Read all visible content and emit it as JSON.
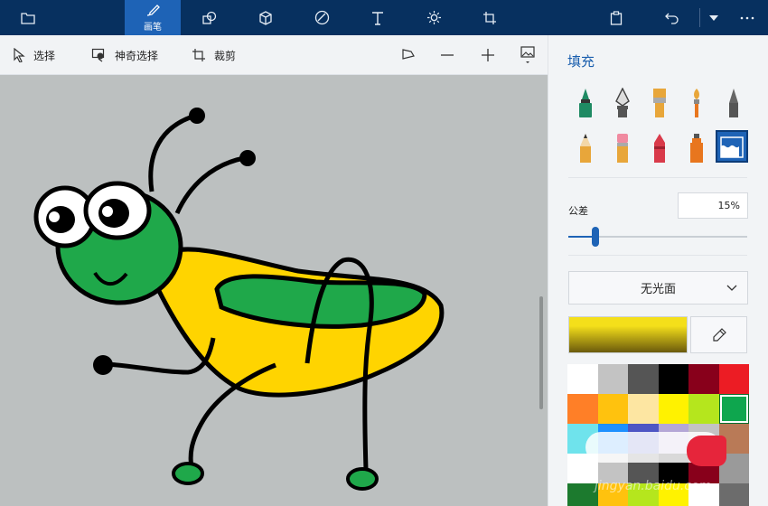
{
  "toolbar": {
    "brushes_label": "画笔",
    "buttons": [
      "open-menu",
      "brushes",
      "2d-shapes",
      "3d-shapes",
      "stickers",
      "text",
      "effects",
      "canvas",
      "paste",
      "undo",
      "history",
      "more"
    ]
  },
  "subtoolbar": {
    "select_label": "选择",
    "magic_select_label": "神奇选择",
    "crop_label": "裁剪"
  },
  "panel": {
    "title": "填充",
    "tolerance_label": "公差",
    "tolerance_value": "15%",
    "tolerance_percent": 15,
    "finish_value": "无光面",
    "current_color_top": "#f4df1a",
    "current_color_bottom": "#6b5a0c"
  },
  "brushes": [
    {
      "name": "marker-brush-icon",
      "color": "#1f8a63"
    },
    {
      "name": "calligraphy-pen-icon",
      "color": "#555"
    },
    {
      "name": "oil-brush-icon",
      "color": "#e8a63a"
    },
    {
      "name": "watercolor-brush-icon",
      "color": "#e8a63a"
    },
    {
      "name": "pixel-pen-icon",
      "color": "#555"
    },
    {
      "name": "pencil-icon",
      "color": "#e8a63a"
    },
    {
      "name": "eraser-icon",
      "color": "#e8a63a"
    },
    {
      "name": "crayon-icon",
      "color": "#d93a4a"
    },
    {
      "name": "spray-can-icon",
      "color": "#e8761e"
    },
    {
      "name": "fill-bucket-icon",
      "color": "#ffffff"
    }
  ],
  "palette": [
    "#ffffff",
    "#c3c3c3",
    "#555555",
    "#000000",
    "#88001b",
    "#ec1c24",
    "#ff7f27",
    "#ffc20e",
    "#fde6a2",
    "#fff200",
    "#b5e61d",
    "#0ea64e",
    "#6fe3ec",
    "#1e90ff",
    "#4e56c4",
    "#b4a7d6",
    "#c3c3c3",
    "#b97a57",
    "#ffffff",
    "#c3c3c3",
    "#555555",
    "#000000",
    "#88001b",
    "#9a9a9a",
    "#1c7a2e",
    "#ffc20e",
    "#b5e61d",
    "#fff200",
    "#ffffff",
    "#6c6c6c"
  ],
  "selected_palette_index": 11,
  "watermark": "jingyan.baidu.com"
}
